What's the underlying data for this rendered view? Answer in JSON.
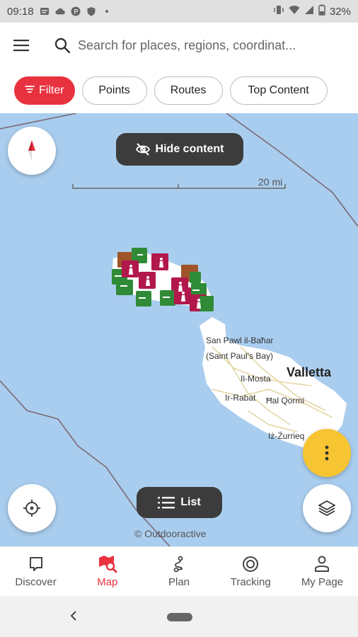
{
  "status_bar": {
    "time": "09:18",
    "battery": "32%"
  },
  "search": {
    "placeholder": "Search for places, regions, coordinat..."
  },
  "filters": {
    "filter_label": "Filter",
    "chips": [
      "Points",
      "Routes",
      "Top Content"
    ]
  },
  "map": {
    "hide_content_label": "Hide content",
    "scale_label": "20 mi",
    "list_label": "List",
    "copyright": "© Outdooractive",
    "places": {
      "san_pawl": "San Pawl il-Baħar",
      "saint_pauls_bay": "(Saint Paul's Bay)",
      "mosta": "Il-Mosta",
      "valletta": "Valletta",
      "rabat": "Ir-Rabat",
      "qormi": "Ħal Qormi",
      "zurrieq": "Iż-Żurrieq"
    },
    "colors": {
      "sea": "#a9cdee",
      "land": "#ffffff",
      "accent": "#e8323f",
      "fab_more": "#f7c531"
    }
  },
  "nav": {
    "discover": "Discover",
    "map": "Map",
    "plan": "Plan",
    "tracking": "Tracking",
    "my_page": "My Page"
  }
}
